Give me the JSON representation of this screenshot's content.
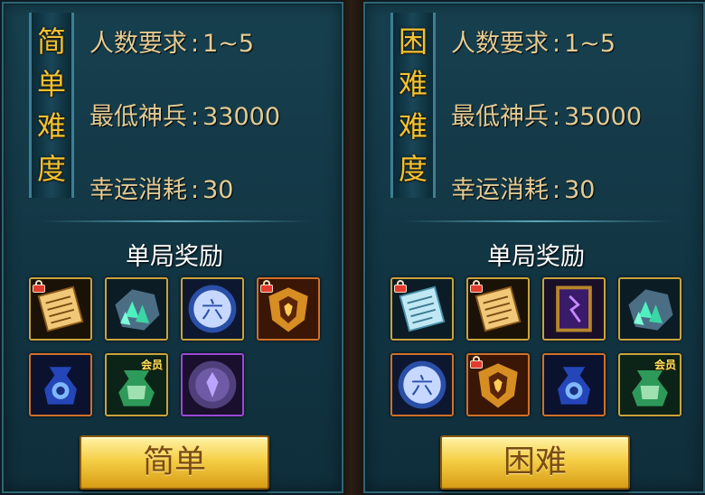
{
  "panels": {
    "easy": {
      "difficulty_chars": [
        "简",
        "单",
        "难",
        "度"
      ],
      "players_label": "人数要求",
      "players_value": "1~5",
      "min_weapon_label": "最低神兵",
      "min_weapon_value": "33000",
      "luck_label": "幸运消耗",
      "luck_value": "30",
      "reward_title": "单局奖励",
      "rewards": [
        {
          "icon": "scroll-icon",
          "locked": true,
          "vip": ""
        },
        {
          "icon": "crystal-ore-icon",
          "locked": false,
          "vip": ""
        },
        {
          "icon": "six-rune-orb-icon",
          "locked": false,
          "vip": ""
        },
        {
          "icon": "golden-armor-icon",
          "locked": true,
          "vip": ""
        },
        {
          "icon": "blue-pouch-icon",
          "locked": false,
          "vip": ""
        },
        {
          "icon": "green-pouch-icon",
          "locked": false,
          "vip": "会员"
        },
        {
          "icon": "purple-emblem-icon",
          "locked": false,
          "vip": ""
        }
      ],
      "button_label": "简单"
    },
    "hard": {
      "difficulty_chars": [
        "困",
        "难",
        "难",
        "度"
      ],
      "players_label": "人数要求",
      "players_value": "1~5",
      "min_weapon_label": "最低神兵",
      "min_weapon_value": "35000",
      "luck_label": "幸运消耗",
      "luck_value": "30",
      "reward_title": "单局奖励",
      "rewards": [
        {
          "icon": "blue-scroll-icon",
          "locked": true,
          "vip": ""
        },
        {
          "icon": "scroll-icon",
          "locked": true,
          "vip": ""
        },
        {
          "icon": "purple-card-icon",
          "locked": false,
          "vip": ""
        },
        {
          "icon": "crystal-ore-icon",
          "locked": false,
          "vip": ""
        },
        {
          "icon": "six-rune-orb-icon",
          "locked": false,
          "vip": ""
        },
        {
          "icon": "golden-armor-icon",
          "locked": true,
          "vip": ""
        },
        {
          "icon": "blue-pouch-icon",
          "locked": false,
          "vip": ""
        },
        {
          "icon": "green-pouch-icon",
          "locked": false,
          "vip": "会员"
        }
      ],
      "button_label": "困难"
    }
  },
  "colors": {
    "accent_gold": "#f1c232",
    "label_text": "#e4cb93",
    "panel_bg": "#17404f",
    "button_text": "#7a4b12"
  }
}
